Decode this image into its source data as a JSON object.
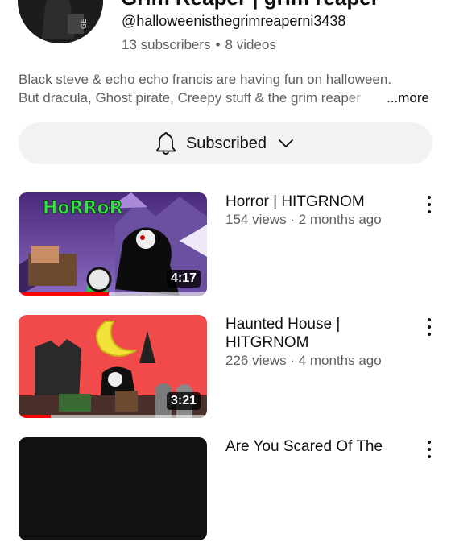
{
  "channel": {
    "title": "Grim Reaper | grim reaper",
    "handle": "@halloweenisthegrimreaperni3438",
    "subscribers": "13 subscribers",
    "videos_count": "8 videos",
    "description_line1": "Black steve & echo echo francis are having fun on halloween.",
    "description_line2": "But dracula, Ghost pirate, Creepy stuff & the grim reaper",
    "more_label": "...more"
  },
  "subscribe_button": {
    "label": "Subscribed",
    "bell_icon": "bell-icon",
    "chevron_icon": "chevron-down-icon"
  },
  "videos": [
    {
      "title_lines": [
        "Horror | HITGRNOM"
      ],
      "meta": "154 views · 2 months ago",
      "duration": "4:17",
      "watched_fraction": 0.48,
      "thumb_text": "HoRRoR"
    },
    {
      "title_lines": [
        "Haunted House |",
        "HITGRNOM"
      ],
      "meta": "226 views · 4 months ago",
      "duration": "3:21",
      "watched_fraction": 0.17,
      "thumb_text": ""
    },
    {
      "title_lines": [
        "Are You Scared Of The"
      ],
      "meta": "",
      "duration": "",
      "watched_fraction": 0,
      "thumb_text": ""
    }
  ],
  "colors": {
    "progress": "#ff0000",
    "secondary_text": "#606060",
    "button_bg": "#f2f2f2"
  }
}
